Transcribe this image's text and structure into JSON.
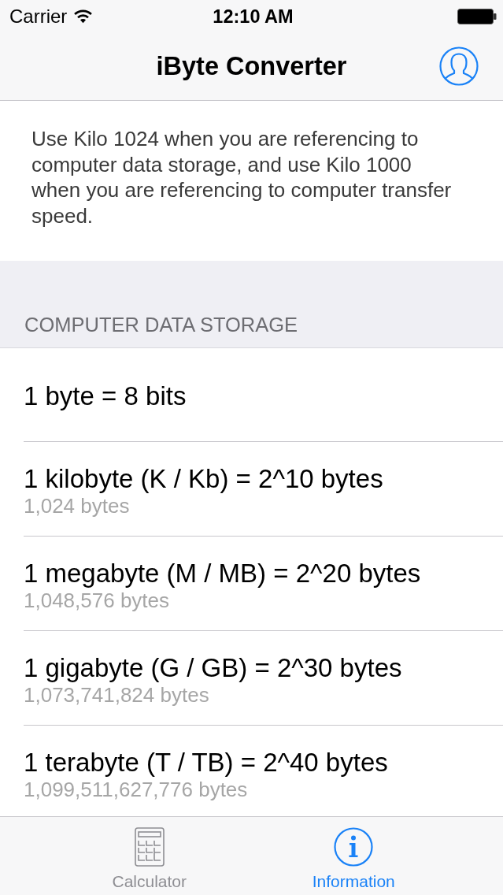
{
  "status_bar": {
    "carrier": "Carrier",
    "time": "12:10 AM"
  },
  "nav_bar": {
    "title": "iByte Converter"
  },
  "note": "Use Kilo 1024 when you are referencing to computer data storage, and use Kilo 1000 when you are referencing to computer transfer speed.",
  "section": {
    "header": "COMPUTER DATA STORAGE",
    "rows": [
      {
        "title": "1 byte = 8 bits"
      },
      {
        "title": "1 kilobyte (K / Kb) = 2^10 bytes",
        "detail": "1,024 bytes"
      },
      {
        "title": "1 megabyte (M / MB) = 2^20 bytes",
        "detail": "1,048,576 bytes"
      },
      {
        "title": "1 gigabyte (G / GB) = 2^30 bytes",
        "detail": "1,073,741,824 bytes"
      },
      {
        "title": "1 terabyte (T / TB) = 2^40 bytes",
        "detail": "1,099,511,627,776 bytes"
      }
    ]
  },
  "tab_bar": [
    {
      "kind": "calculator",
      "label": "Calculator",
      "selected": false
    },
    {
      "kind": "info",
      "label": "Information",
      "selected": true
    }
  ]
}
